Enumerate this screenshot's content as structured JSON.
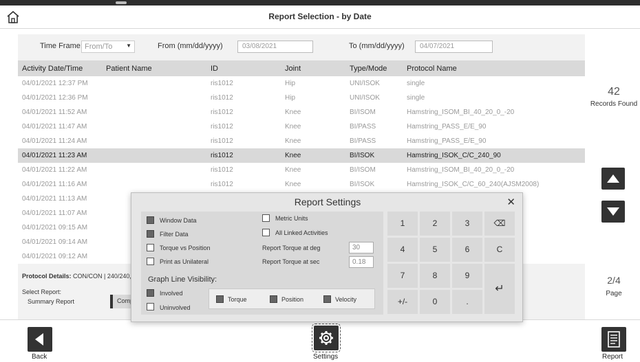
{
  "window": {
    "title": "Report Selection - by Date"
  },
  "filter": {
    "time_frame_label": "Time Frame:",
    "time_frame_value": "From/To",
    "from_label": "From (mm/dd/yyyy)",
    "from_value": "03/08/2021",
    "to_label": "To (mm/dd/yyyy)",
    "to_value": "04/07/2021"
  },
  "table": {
    "columns": [
      "Activity Date/Time",
      "Patient Name",
      "ID",
      "Joint",
      "Type/Mode",
      "Protocol Name"
    ],
    "rows": [
      [
        "04/01/2021 12:37 PM",
        "",
        "ris1012",
        "Hip",
        "UNI/ISOK",
        "single"
      ],
      [
        "04/01/2021 12:36 PM",
        "",
        "ris1012",
        "Hip",
        "UNI/ISOK",
        "single"
      ],
      [
        "04/01/2021 11:52 AM",
        "",
        "ris1012",
        "Knee",
        "BI/ISOM",
        "Hamstring_ISOM_BI_40_20_0_-20"
      ],
      [
        "04/01/2021 11:47 AM",
        "",
        "ris1012",
        "Knee",
        "BI/PASS",
        "Hamstring_PASS_E/E_90"
      ],
      [
        "04/01/2021 11:24 AM",
        "",
        "ris1012",
        "Knee",
        "BI/PASS",
        "Hamstring_PASS_E/E_90"
      ],
      [
        "04/01/2021 11:23 AM",
        "",
        "ris1012",
        "Knee",
        "BI/ISOK",
        "Hamstring_ISOK_C/C_240_90"
      ],
      [
        "04/01/2021 11:22 AM",
        "",
        "ris1012",
        "Knee",
        "BI/ISOM",
        "Hamstring_ISOM_BI_40_20_0_-20"
      ],
      [
        "04/01/2021 11:16 AM",
        "",
        "ris1012",
        "Knee",
        "BI/ISOK",
        "Hamstring_ISOK_C/C_60_240(AJSM2008)"
      ],
      [
        "04/01/2021 11:13 AM",
        "",
        "",
        "",
        "",
        ""
      ],
      [
        "04/01/2021 11:07 AM",
        "",
        "",
        "",
        "",
        ""
      ],
      [
        "04/01/2021 09:15 AM",
        "",
        "",
        "",
        "",
        ""
      ],
      [
        "04/01/2021 09:14 AM",
        "",
        "",
        "",
        "",
        ""
      ],
      [
        "04/01/2021 09:12 AM",
        "",
        "",
        "",
        "",
        ""
      ]
    ],
    "selected_row": 5
  },
  "details": {
    "protocol_label": "Protocol Details:",
    "protocol_value": "CON/CON | 240/240,",
    "select_report_label": "Select Report:",
    "summary_report": "Summary Report",
    "comp_label": "Comp"
  },
  "side": {
    "records_count": "42",
    "records_label": "Records Found",
    "page_value": "2/4",
    "page_label": "Page"
  },
  "bottom": {
    "back_label": "Back",
    "settings_label": "Settings",
    "report_label": "Report"
  },
  "dialog": {
    "title": "Report Settings",
    "close": "✕",
    "options": {
      "window_data": "Window Data",
      "filter_data": "Filter Data",
      "torque_vs_position": "Torque vs Position",
      "print_as_unilateral": "Print as Unilateral",
      "metric_units": "Metric Units",
      "all_linked_activities": "All Linked Activities",
      "report_torque_deg_label": "Report Torque at deg",
      "report_torque_deg_value": "30",
      "report_torque_sec_label": "Report Torque at sec",
      "report_torque_sec_value": "0.18"
    },
    "graph_line_visibility": "Graph Line Visibility:",
    "involved": "Involved",
    "uninvolved": "Uninvolved",
    "torque": "Torque",
    "position": "Position",
    "velocity": "Velocity",
    "keypad": {
      "k1": "1",
      "k2": "2",
      "k3": "3",
      "kbs": "⌫",
      "k4": "4",
      "k5": "5",
      "k6": "6",
      "kc": "C",
      "k7": "7",
      "k8": "8",
      "k9": "9",
      "kenter": "↵",
      "kpm": "+/-",
      "k0": "0",
      "kdot": "."
    }
  }
}
